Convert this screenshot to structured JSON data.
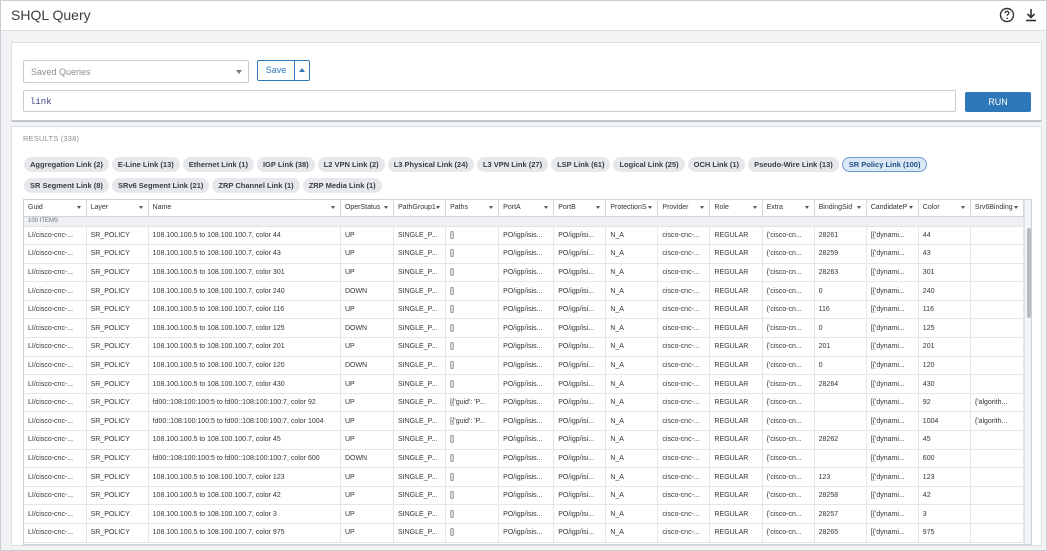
{
  "header": {
    "title": "SHQL Query",
    "help_icon": "help-circle-icon",
    "download_icon": "download-icon"
  },
  "query_panel": {
    "saved_queries_placeholder": "Saved Queries",
    "save_label": "Save",
    "query_value": "link",
    "run_label": "RUN"
  },
  "results": {
    "label": "RESULTS (338)",
    "group_label": "100 ITEMS",
    "chips_row1": [
      "Aggregation Link (2)",
      "E-Line Link (13)",
      "Ethernet Link (1)",
      "IGP Link (38)",
      "L2 VPN Link (2)",
      "L3 Physical Link (24)",
      "L3 VPN Link (27)",
      "LSP Link (61)",
      "Logical Link (25)",
      "OCH Link (1)",
      "Pseudo-Wire Link (13)",
      "SR Policy Link (100)"
    ],
    "chips_row2": [
      "SR Segment Link (8)",
      "SRv6 Segment Link (21)",
      "ZRP Channel Link (1)",
      "ZRP Media Link (1)"
    ],
    "active_chip": "SR Policy Link (100)",
    "columns": [
      "Guid",
      "Layer",
      "Name",
      "OperStatus",
      "PathGroup1",
      "Paths",
      "PortA",
      "PortB",
      "ProtectionS",
      "Provider",
      "Role",
      "Extra",
      "BindingSid",
      "CandidateP",
      "Color",
      "Srv6Binding"
    ],
    "rows": [
      [
        "LI/cisco-cnc-...",
        "SR_POLICY",
        "108.100.100.5 to 108.100.100.7, color 44",
        "UP",
        "SINGLE_P...",
        "[]",
        "PO/igp/isis...",
        "PO/igp/isi...",
        "N_A",
        "cisco-cnc-...",
        "REGULAR",
        "{'cisco-cn...",
        "28261",
        "[{'dynami...",
        "44",
        ""
      ],
      [
        "LI/cisco-cnc-...",
        "SR_POLICY",
        "108.100.100.5 to 108.100.100.7, color 43",
        "UP",
        "SINGLE_P...",
        "[]",
        "PO/igp/isis...",
        "PO/igp/isi...",
        "N_A",
        "cisco-cnc-...",
        "REGULAR",
        "{'cisco-cn...",
        "28259",
        "[{'dynami...",
        "43",
        ""
      ],
      [
        "LI/cisco-cnc-...",
        "SR_POLICY",
        "108.100.100.5 to 108.100.100.7, color 301",
        "UP",
        "SINGLE_P...",
        "[]",
        "PO/igp/isis...",
        "PO/igp/isi...",
        "N_A",
        "cisco-cnc-...",
        "REGULAR",
        "{'cisco-cn...",
        "28263",
        "[{'dynami...",
        "301",
        ""
      ],
      [
        "LI/cisco-cnc-...",
        "SR_POLICY",
        "108.100.100.5 to 108.100.100.7, color 240",
        "DOWN",
        "SINGLE_P...",
        "[]",
        "PO/igp/isis...",
        "PO/igp/isi...",
        "N_A",
        "cisco-cnc-...",
        "REGULAR",
        "{'cisco-cn...",
        "0",
        "[{'dynami...",
        "240",
        ""
      ],
      [
        "LI/cisco-cnc-...",
        "SR_POLICY",
        "108.100.100.5 to 108.100.100.7, color 116",
        "UP",
        "SINGLE_P...",
        "[]",
        "PO/igp/isis...",
        "PO/igp/isi...",
        "N_A",
        "cisco-cnc-...",
        "REGULAR",
        "{'cisco-cn...",
        "116",
        "[{'dynami...",
        "116",
        ""
      ],
      [
        "LI/cisco-cnc-...",
        "SR_POLICY",
        "108.100.100.5 to 108.100.100.7, color 125",
        "DOWN",
        "SINGLE_P...",
        "[]",
        "PO/igp/isis...",
        "PO/igp/isi...",
        "N_A",
        "cisco-cnc-...",
        "REGULAR",
        "{'cisco-cn...",
        "0",
        "[{'dynami...",
        "125",
        ""
      ],
      [
        "LI/cisco-cnc-...",
        "SR_POLICY",
        "108.100.100.5 to 108.100.100.7, color 201",
        "UP",
        "SINGLE_P...",
        "[]",
        "PO/igp/isis...",
        "PO/igp/isi...",
        "N_A",
        "cisco-cnc-...",
        "REGULAR",
        "{'cisco-cn...",
        "201",
        "[{'dynami...",
        "201",
        ""
      ],
      [
        "LI/cisco-cnc-...",
        "SR_POLICY",
        "108.100.100.5 to 108.100.100.7, color 120",
        "DOWN",
        "SINGLE_P...",
        "[]",
        "PO/igp/isis...",
        "PO/igp/isi...",
        "N_A",
        "cisco-cnc-...",
        "REGULAR",
        "{'cisco-cn...",
        "0",
        "[{'dynami...",
        "120",
        ""
      ],
      [
        "LI/cisco-cnc-...",
        "SR_POLICY",
        "108.100.100.5 to 108.100.100.7, color 430",
        "UP",
        "SINGLE_P...",
        "[]",
        "PO/igp/isis...",
        "PO/igp/isi...",
        "N_A",
        "cisco-cnc-...",
        "REGULAR",
        "{'cisco-cn...",
        "28264",
        "[{'dynami...",
        "430",
        ""
      ],
      [
        "LI/cisco-cnc-...",
        "SR_POLICY",
        "fd00::108:100:100:5 to fd00::108:100:100:7, color 92",
        "UP",
        "SINGLE_P...",
        "[{'guid': 'P...",
        "PO/igp/isis...",
        "PO/igp/isi...",
        "N_A",
        "cisco-cnc-...",
        "REGULAR",
        "{'cisco-cn...",
        "",
        "[{'dynami...",
        "92",
        "{'algorith..."
      ],
      [
        "LI/cisco-cnc-...",
        "SR_POLICY",
        "fd00::108:100:100:5 to fd00::108:100:100:7, color 1004",
        "UP",
        "SINGLE_P...",
        "[{'guid': 'P...",
        "PO/igp/isis...",
        "PO/igp/isi...",
        "N_A",
        "cisco-cnc-...",
        "REGULAR",
        "{'cisco-cn...",
        "",
        "[{'dynami...",
        "1004",
        "{'algorith..."
      ],
      [
        "LI/cisco-cnc-...",
        "SR_POLICY",
        "108.100.100.5 to 108.100.100.7, color 45",
        "UP",
        "SINGLE_P...",
        "[]",
        "PO/igp/isis...",
        "PO/igp/isi...",
        "N_A",
        "cisco-cnc-...",
        "REGULAR",
        "{'cisco-cn...",
        "28262",
        "[{'dynami...",
        "45",
        ""
      ],
      [
        "LI/cisco-cnc-...",
        "SR_POLICY",
        "fd00::108:100:100:5 to fd00::108:100:100:7, color 600",
        "DOWN",
        "SINGLE_P...",
        "[]",
        "PO/igp/isis...",
        "PO/igp/isi...",
        "N_A",
        "cisco-cnc-...",
        "REGULAR",
        "{'cisco-cn...",
        "",
        "[{'dynami...",
        "600",
        ""
      ],
      [
        "LI/cisco-cnc-...",
        "SR_POLICY",
        "108.100.100.5 to 108.100.100.7, color 123",
        "UP",
        "SINGLE_P...",
        "[]",
        "PO/igp/isis...",
        "PO/igp/isi...",
        "N_A",
        "cisco-cnc-...",
        "REGULAR",
        "{'cisco-cn...",
        "123",
        "[{'dynami...",
        "123",
        ""
      ],
      [
        "LI/cisco-cnc-...",
        "SR_POLICY",
        "108.100.100.5 to 108.100.100.7, color 42",
        "UP",
        "SINGLE_P...",
        "[]",
        "PO/igp/isis...",
        "PO/igp/isi...",
        "N_A",
        "cisco-cnc-...",
        "REGULAR",
        "{'cisco-cn...",
        "28258",
        "[{'dynami...",
        "42",
        ""
      ],
      [
        "LI/cisco-cnc-...",
        "SR_POLICY",
        "108.100.100.5 to 108.100.100.7, color 3",
        "UP",
        "SINGLE_P...",
        "[]",
        "PO/igp/isis...",
        "PO/igp/isi...",
        "N_A",
        "cisco-cnc-...",
        "REGULAR",
        "{'cisco-cn...",
        "28257",
        "[{'dynami...",
        "3",
        ""
      ],
      [
        "LI/cisco-cnc-...",
        "SR_POLICY",
        "108.100.100.5 to 108.100.100.7, color 975",
        "UP",
        "SINGLE_P...",
        "[]",
        "PO/igp/isis...",
        "PO/igp/isi...",
        "N_A",
        "cisco-cnc-...",
        "REGULAR",
        "{'cisco-cn...",
        "28265",
        "[{'dynami...",
        "975",
        ""
      ]
    ]
  },
  "colors": {
    "accent": "#2e77b8",
    "chip_active_bg": "#dbe8f6",
    "chip_bg": "#e6e8eb"
  }
}
